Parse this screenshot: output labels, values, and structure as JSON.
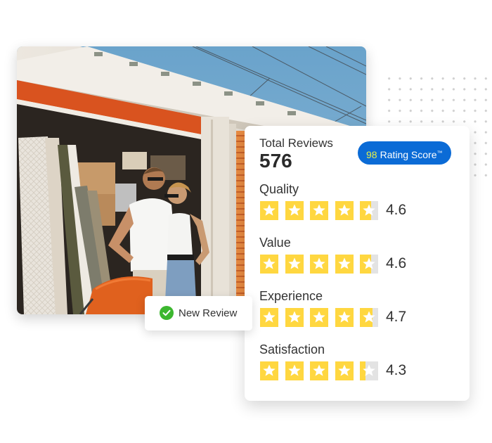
{
  "photo": {
    "description": "Smiling couple in white shirts standing in front of an open orange-door self-storage unit filled with mattresses, boxes and furniture, orange chair in foreground"
  },
  "summary": {
    "total_reviews_label": "Total Reviews",
    "total_reviews_value": "576",
    "badge": {
      "score": "98",
      "label": "Rating Score",
      "trademark": "™",
      "background_color": "#0b6bd6",
      "score_color": "#e6f046"
    }
  },
  "ratings": [
    {
      "name": "Quality",
      "value": "4.6",
      "score": 4.6
    },
    {
      "name": "Value",
      "value": "4.6",
      "score": 4.6
    },
    {
      "name": "Experience",
      "value": "4.7",
      "score": 4.7
    },
    {
      "name": "Satisfaction",
      "value": "4.3",
      "score": 4.3
    }
  ],
  "rating_max": 5,
  "star_colors": {
    "filled": "#ffd740",
    "empty": "#e3e3e3",
    "glyph": "#ffffff"
  },
  "toast": {
    "icon": "check-circle-icon",
    "text": "New Review",
    "icon_color": "#3cb72f"
  }
}
